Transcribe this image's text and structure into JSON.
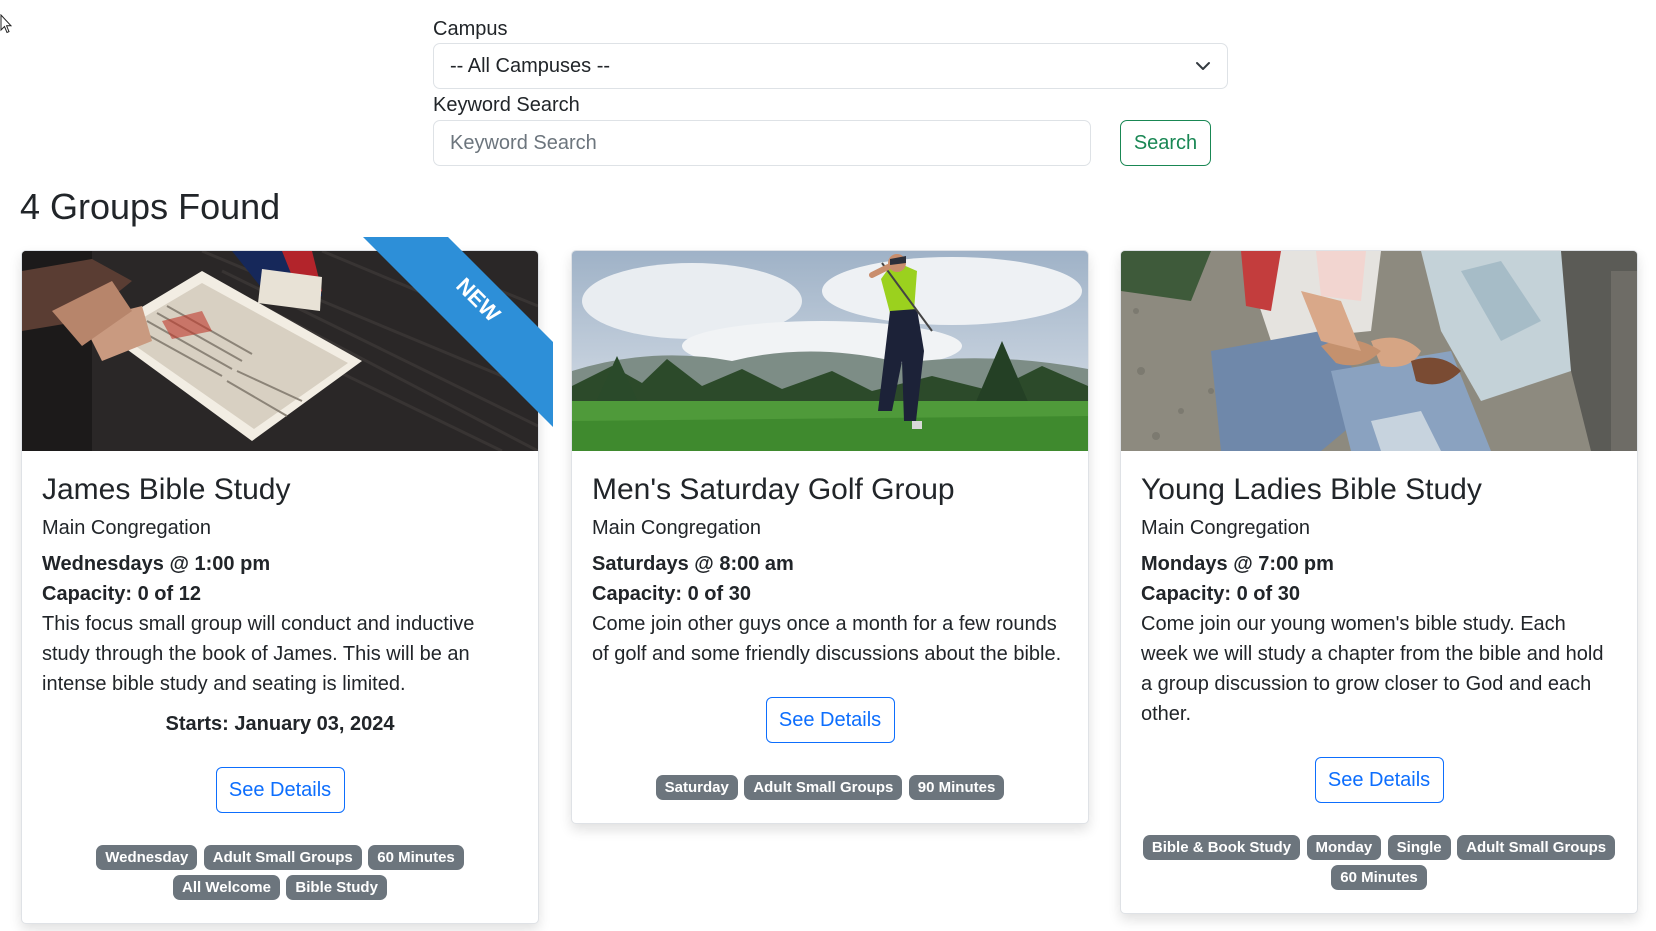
{
  "filters": {
    "campus_label": "Campus",
    "campus_selected": "-- All Campuses --",
    "keyword_label": "Keyword Search",
    "keyword_placeholder": "Keyword Search",
    "search_button": "Search"
  },
  "results_title": "4 Groups Found",
  "groups": [
    {
      "title": "James Bible Study",
      "campus": "Main Congregation",
      "meeting": "Wednesdays @ 1:00 pm",
      "capacity": "Capacity: 0 of 12",
      "description": "This focus small group will conduct and inductive study through the book of James. This will be an intense bible study and seating is limited.",
      "starts": "Starts: January 03, 2024",
      "details_button": "See Details",
      "ribbon": "NEW",
      "tags": [
        "Wednesday",
        "Adult Small Groups",
        "60 Minutes",
        "All Welcome",
        "Bible Study"
      ]
    },
    {
      "title": "Men's Saturday Golf Group",
      "campus": "Main Congregation",
      "meeting": "Saturdays @ 8:00 am",
      "capacity": "Capacity: 0 of 30",
      "description": "Come join other guys once a month for a few rounds of golf and some friendly discussions about the bible.",
      "details_button": "See Details",
      "tags": [
        "Saturday",
        "Adult Small Groups",
        "90 Minutes"
      ]
    },
    {
      "title": "Young Ladies Bible Study",
      "campus": "Main Congregation",
      "meeting": "Mondays @ 7:00 pm",
      "capacity": "Capacity: 0 of 30",
      "description": "Come join our young women's bible study. Each week we will study a chapter from the bible and hold a group discussion to grow closer to God and each other.",
      "details_button": "See Details",
      "tags": [
        "Bible & Book Study",
        "Monday",
        "Single",
        "Adult Small Groups",
        "60 Minutes"
      ]
    }
  ],
  "colors": {
    "ribbon": "#2d8fd8",
    "tag_bg": "#6c757d",
    "details_button": "#0d6efd",
    "search_button": "#198754"
  },
  "icons": [
    "cursor-icon",
    "chevron-down-icon"
  ]
}
